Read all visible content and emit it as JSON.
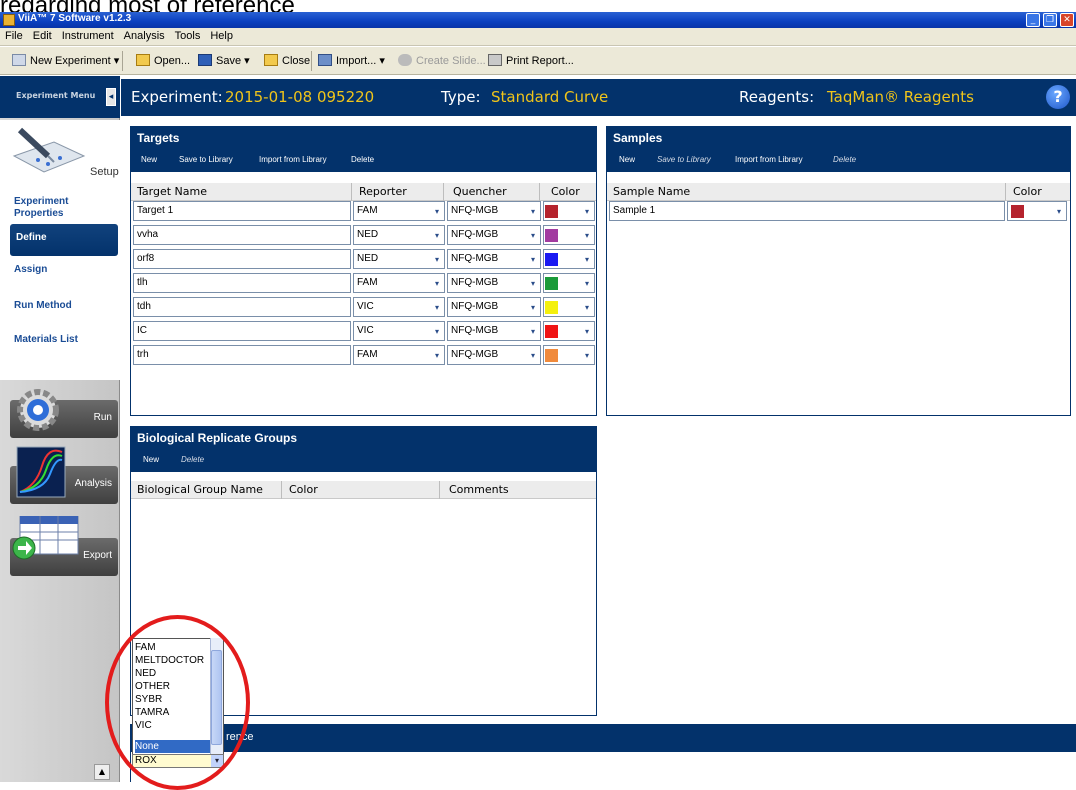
{
  "caption": "regarding most of reference",
  "window": {
    "title": "ViiA™ 7 Software v1.2.3"
  },
  "menu": [
    "File",
    "Edit",
    "Instrument",
    "Analysis",
    "Tools",
    "Help"
  ],
  "toolbar": {
    "new_experiment": "New Experiment",
    "open": "Open...",
    "save": "Save",
    "close": "Close",
    "import": "Import...",
    "create_slide": "Create Slide...",
    "print_report": "Print Report..."
  },
  "sidebar": {
    "menu_label": "Experiment Menu",
    "setup": "Setup",
    "items": {
      "experiment_properties": "Experiment Properties",
      "define": "Define",
      "assign": "Assign",
      "run_method": "Run Method",
      "materials_list": "Materials List"
    },
    "run": "Run",
    "analysis": "Analysis",
    "export": "Export"
  },
  "header": {
    "experiment_label": "Experiment:",
    "experiment_value": "2015-01-08 095220",
    "type_label": "Type:",
    "type_value": "Standard Curve",
    "reagents_label": "Reagents:",
    "reagents_value": "TaqMan® Reagents"
  },
  "targets": {
    "title": "Targets",
    "actions": {
      "new": "New",
      "save": "Save to Library",
      "import": "Import from Library",
      "delete": "Delete"
    },
    "columns": [
      "Target Name",
      "Reporter",
      "Quencher",
      "Color"
    ],
    "rows": [
      {
        "name": "Target 1",
        "reporter": "FAM",
        "quencher": "NFQ-MGB",
        "color": "#b5232d"
      },
      {
        "name": "vvha",
        "reporter": "NED",
        "quencher": "NFQ-MGB",
        "color": "#a23ba0"
      },
      {
        "name": "orf8",
        "reporter": "NED",
        "quencher": "NFQ-MGB",
        "color": "#1a1af2"
      },
      {
        "name": "tlh",
        "reporter": "FAM",
        "quencher": "NFQ-MGB",
        "color": "#1a9a3a"
      },
      {
        "name": "tdh",
        "reporter": "VIC",
        "quencher": "NFQ-MGB",
        "color": "#f4f00e"
      },
      {
        "name": "IC",
        "reporter": "VIC",
        "quencher": "NFQ-MGB",
        "color": "#f01414"
      },
      {
        "name": "trh",
        "reporter": "FAM",
        "quencher": "NFQ-MGB",
        "color": "#f08a3c"
      }
    ]
  },
  "samples": {
    "title": "Samples",
    "actions": {
      "new": "New",
      "save": "Save to Library",
      "import": "Import from Library",
      "delete": "Delete"
    },
    "columns": [
      "Sample Name",
      "Color"
    ],
    "rows": [
      {
        "name": "Sample 1",
        "color": "#b5232d"
      }
    ]
  },
  "bio_groups": {
    "title": "Biological Replicate Groups",
    "actions": {
      "new": "New",
      "delete": "Delete"
    },
    "columns": [
      "Biological Group Name",
      "Color",
      "Comments"
    ]
  },
  "bottom_panel": {
    "title_fragment": "rence"
  },
  "dropdown": {
    "options": [
      "FAM",
      "MELTDOCTOR",
      "NED",
      "OTHER",
      "SYBR",
      "TAMRA",
      "VIC",
      "None"
    ],
    "selected": "None",
    "current_value": "ROX"
  }
}
